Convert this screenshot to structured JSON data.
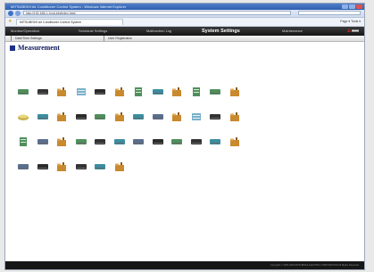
{
  "browser": {
    "title": "MITSUBISHI Air Conditioner Control System - Windows Internet Explorer",
    "url": "http://192.168.1.1/cgi-bin/index.html",
    "tab_label": "MITSUBISHI Air Conditioner Control System",
    "tools_label": "Page ▾  Tools ▾"
  },
  "menu": {
    "items": [
      {
        "label": "Monitor/Operation",
        "active": false
      },
      {
        "label": "Schedule Settings",
        "active": false
      },
      {
        "label": "Malfunction Log",
        "active": false
      },
      {
        "label": "System Settings",
        "active": true
      },
      {
        "label": "Maintenance",
        "active": false
      }
    ],
    "brand": "MITSUBISHI ELECTRIC"
  },
  "submenu": {
    "items": [
      "Date/Time Settings",
      "User Registration"
    ]
  },
  "page": {
    "title": "Measurement"
  },
  "icon_rows": [
    [
      "indoor-unit-icon",
      "indoor-unit-icon",
      "folder-icon",
      "lossnay-icon",
      "indoor-unit-icon",
      "folder-icon",
      "outdoor-unit-icon",
      "indoor-unit-icon",
      "folder-icon",
      "outdoor-unit-icon",
      "indoor-unit-icon",
      "folder-icon"
    ],
    [
      "sensor-icon",
      "indoor-unit-icon",
      "folder-icon",
      "indoor-unit-icon",
      "indoor-unit-icon",
      "folder-icon",
      "indoor-unit-icon",
      "indoor-unit-icon",
      "folder-icon",
      "lossnay-icon",
      "indoor-unit-icon",
      "folder-icon"
    ],
    [
      "outdoor-unit-icon",
      "indoor-unit-icon",
      "folder-icon",
      "indoor-unit-icon",
      "indoor-unit-icon",
      "indoor-unit-icon",
      "indoor-unit-icon",
      "indoor-unit-icon",
      "indoor-unit-icon",
      "indoor-unit-icon",
      "indoor-unit-icon",
      "folder-icon"
    ],
    [
      "indoor-unit-icon",
      "indoor-unit-icon",
      "folder-icon",
      "indoor-unit-icon",
      "indoor-unit-icon",
      "folder-icon"
    ]
  ],
  "footer": {
    "copyright": "Copyright © 2005-2009 MITSUBISHI ELECTRIC CORPORATION All Rights Reserved"
  },
  "colors": {
    "menubar": "#1f1f1f",
    "title_blue": "#1d2f87",
    "folder": "#c9892e",
    "unit_green": "#4f8f5b",
    "unit_dark": "#333333",
    "unit_teal": "#3c8ea0"
  }
}
